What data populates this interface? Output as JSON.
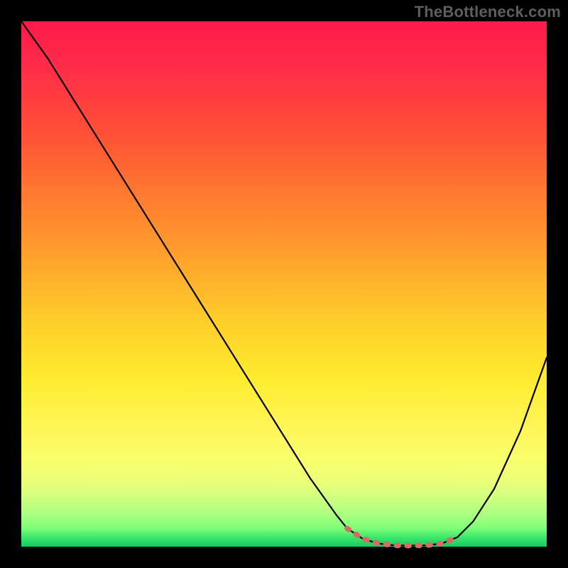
{
  "watermark": "TheBottleneck.com",
  "colors": {
    "background": "#000000",
    "curve": "#000000",
    "marker": "#d86a64",
    "watermark_text": "#5e5e5e"
  },
  "chart_data": {
    "type": "line",
    "title": "",
    "xlabel": "",
    "ylabel": "",
    "xlim": [
      0,
      100
    ],
    "ylim": [
      0,
      100
    ],
    "series": [
      {
        "name": "main-curve",
        "x": [
          0,
          5,
          10,
          15,
          20,
          25,
          30,
          35,
          40,
          45,
          50,
          55,
          60,
          62,
          65,
          68,
          71,
          74,
          77,
          80,
          83,
          86,
          90,
          95,
          100
        ],
        "y": [
          100,
          93,
          85,
          77,
          69,
          61,
          53,
          45,
          37,
          29,
          21,
          13,
          6,
          3.5,
          1.5,
          0.6,
          0.25,
          0.2,
          0.25,
          0.6,
          1.8,
          4.8,
          11,
          22,
          36
        ]
      },
      {
        "name": "highlighted-segment",
        "x": [
          62,
          65,
          68,
          71,
          74,
          77,
          80,
          83
        ],
        "y": [
          3.5,
          1.5,
          0.6,
          0.25,
          0.2,
          0.25,
          0.6,
          1.8
        ]
      }
    ],
    "annotations": []
  }
}
